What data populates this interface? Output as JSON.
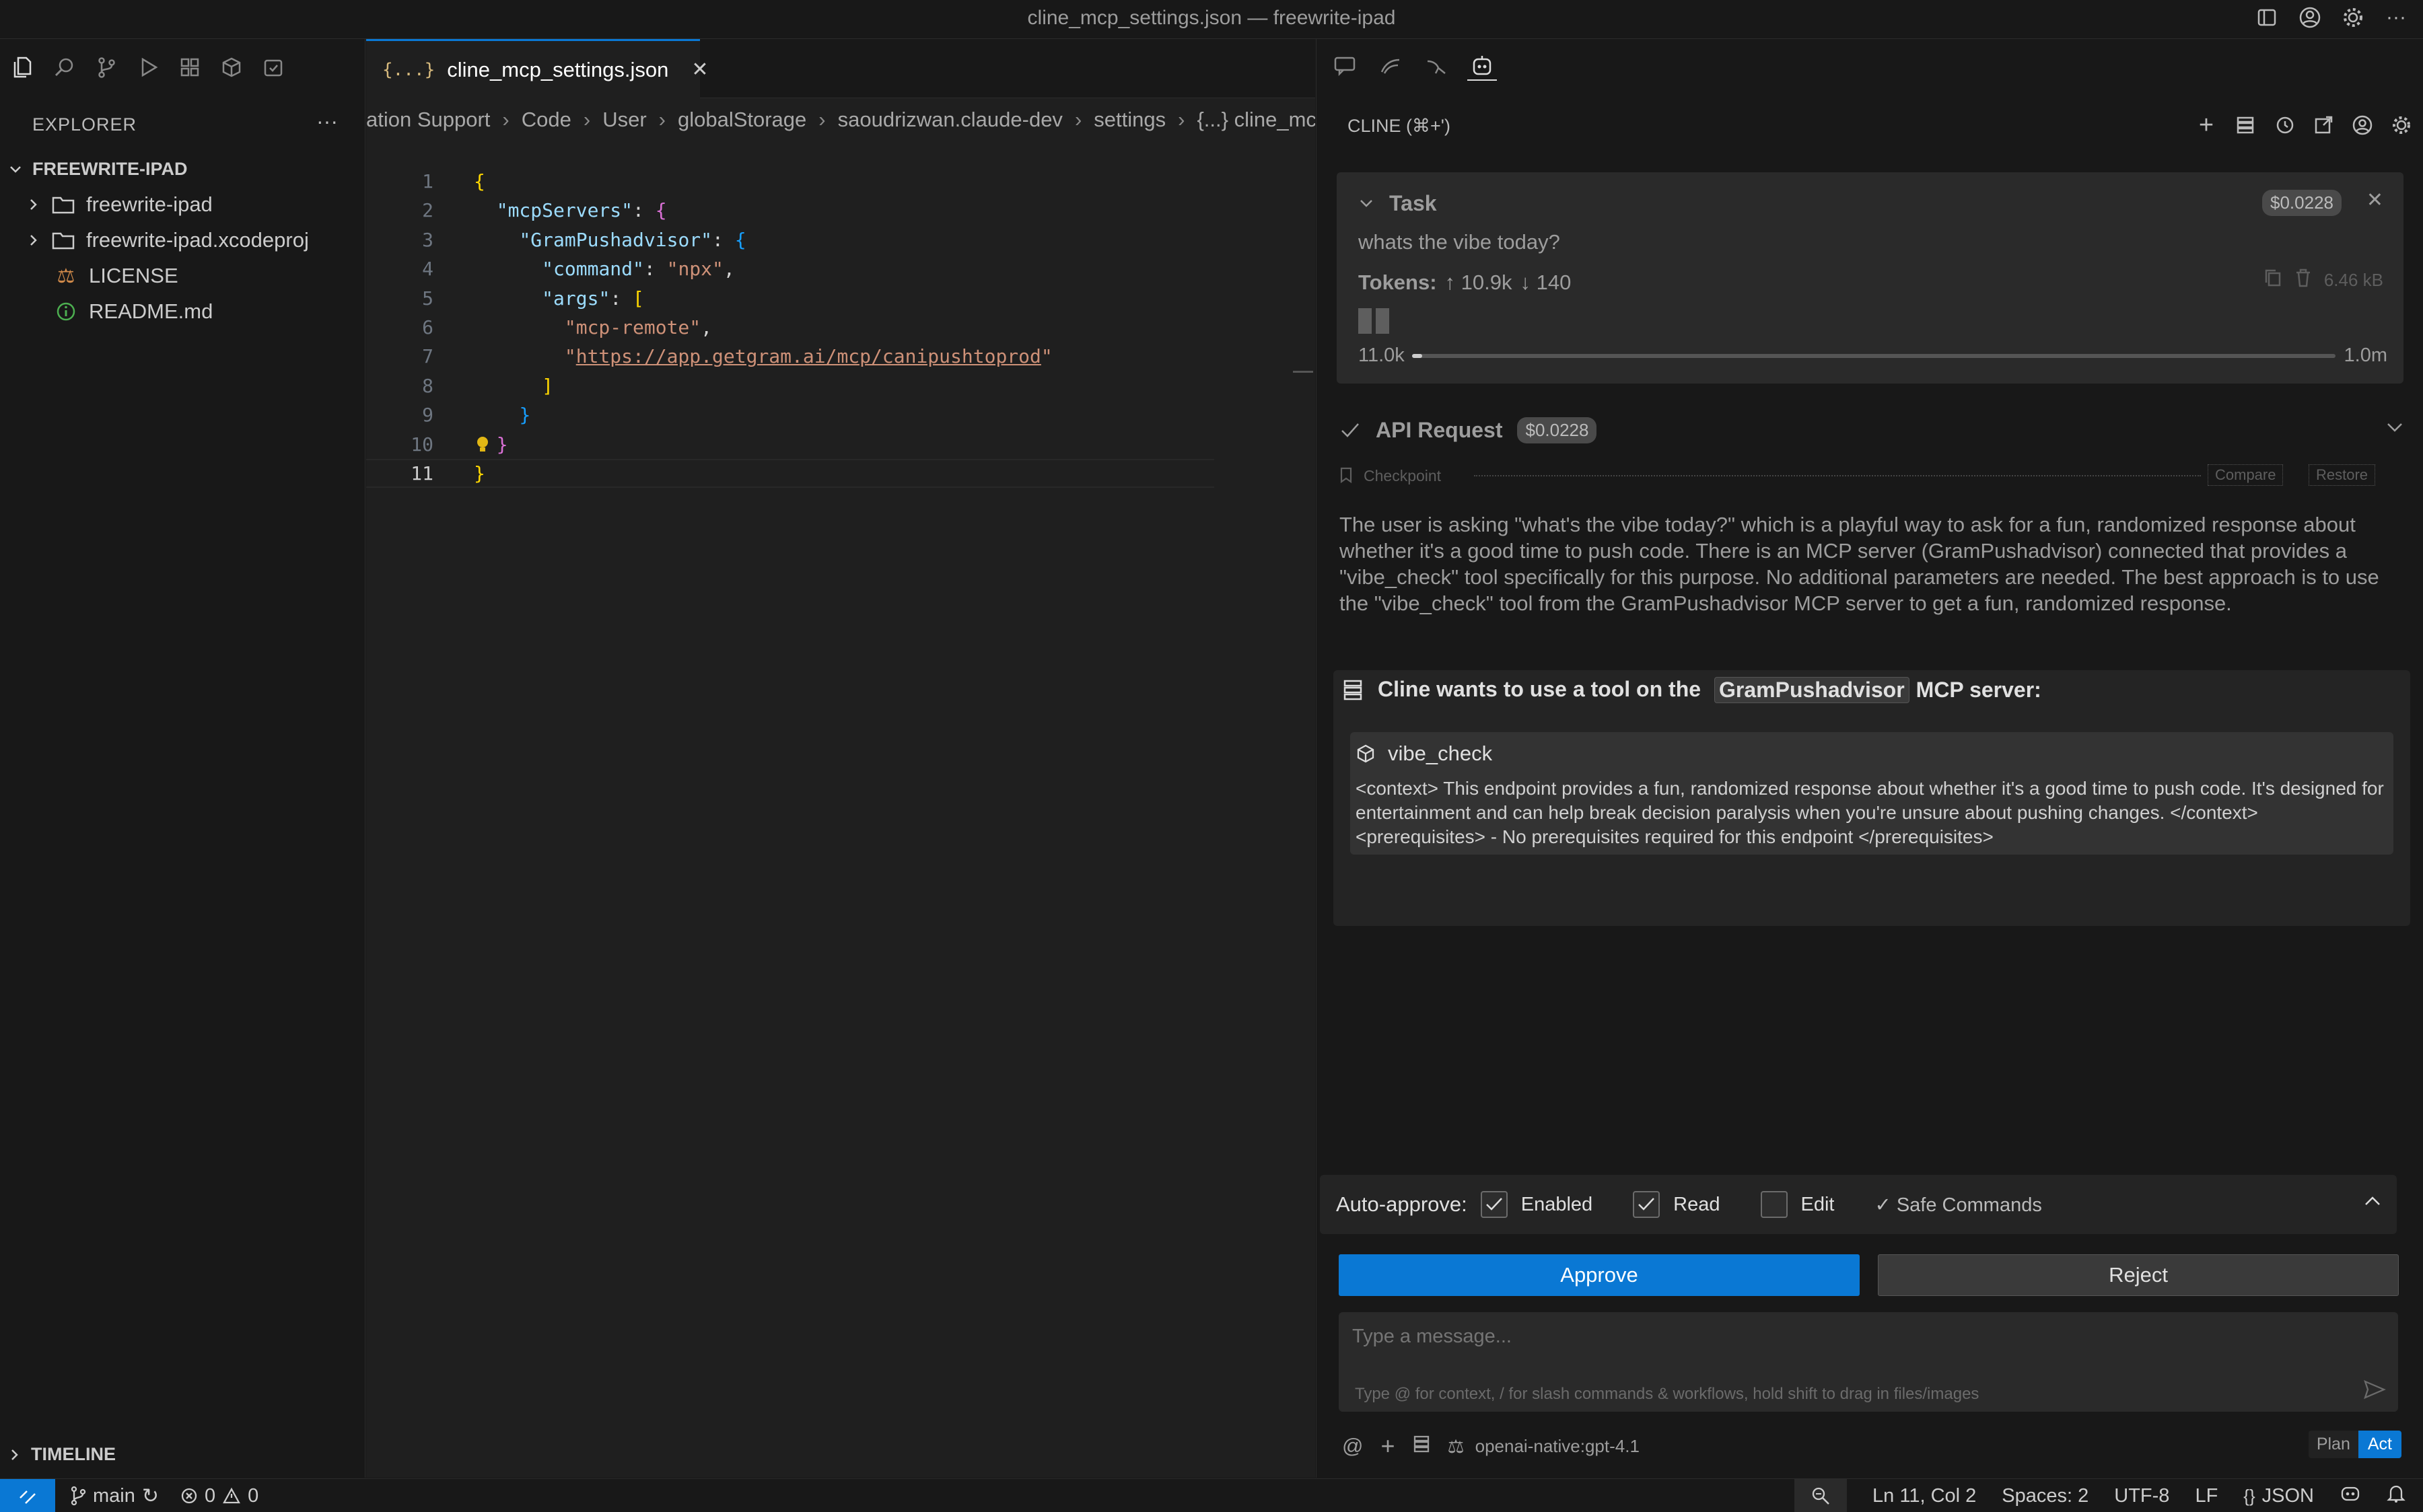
{
  "window": {
    "title": "cline_mcp_settings.json — freewrite-ipad"
  },
  "sidebar": {
    "header": "EXPLORER",
    "root": "FREEWRITE-IPAD",
    "items": [
      {
        "label": "freewrite-ipad",
        "type": "folder"
      },
      {
        "label": "freewrite-ipad.xcodeproj",
        "type": "folder"
      },
      {
        "label": "LICENSE",
        "type": "file"
      },
      {
        "label": "README.md",
        "type": "file"
      }
    ],
    "timeline": "TIMELINE"
  },
  "editor": {
    "tab_label": "cline_mcp_settings.json",
    "tab_icon": "{...}",
    "breadcrumbs": [
      "ation Support",
      "Code",
      "User",
      "globalStorage",
      "saoudrizwan.claude-dev",
      "settings",
      "{...} cline_mc"
    ],
    "line_numbers": [
      "1",
      "2",
      "3",
      "4",
      "5",
      "6",
      "7",
      "8",
      "9",
      "10",
      "11"
    ],
    "code": {
      "l1": "{",
      "l2_key": "\"mcpServers\"",
      "l2_rest": ": ",
      "l2_brace": "{",
      "l3_key": "\"GramPushadvisor\"",
      "l3_rest": ": ",
      "l3_brace": "{",
      "l4_key": "\"command\"",
      "l4_rest": ": ",
      "l4_val": "\"npx\"",
      "l4_end": ",",
      "l5_key": "\"args\"",
      "l5_rest": ": ",
      "l5_brace": "[",
      "l6_val": "\"mcp-remote\"",
      "l6_end": ",",
      "l7_q1": "\"",
      "l7_url": "https://app.getgram.ai/mcp/canipushtoprod",
      "l7_q2": "\"",
      "l8": "]",
      "l9": "}",
      "l10": "}",
      "l11": "}"
    }
  },
  "cline": {
    "header": "CLINE (⌘+')",
    "task": {
      "label": "Task",
      "cost": "$0.0228",
      "prompt": "whats the vibe today?",
      "tokens_label": "Tokens:",
      "tokens_in": "↑ 10.9k",
      "tokens_out": "↓ 140",
      "size": "6.46 kB",
      "context_used": "11.0k",
      "context_max": "1.0m",
      "context_fraction": 0.011
    },
    "api_request": {
      "label": "API Request",
      "cost": "$0.0228"
    },
    "checkpoint": {
      "label": "Checkpoint",
      "compare": "Compare",
      "restore": "Restore"
    },
    "reasoning": "The user is asking \"what's the vibe today?\" which is a playful way to ask for a fun, randomized response about whether it's a good time to push code. There is an MCP server (GramPushadvisor) connected that provides a \"vibe_check\" tool specifically for this purpose. No additional parameters are needed. The best approach is to use the \"vibe_check\" tool from the GramPushadvisor MCP server to get a fun, randomized response.",
    "tool_request": {
      "prefix": "Cline wants to use a tool on the",
      "server": "GramPushadvisor",
      "suffix": "MCP server:",
      "tool_name": "vibe_check",
      "description": "<context> This endpoint provides a fun, randomized response about whether it's a good time to push code. It's designed for entertainment and can help break decision paralysis when you're unsure about pushing changes. </context> <prerequisites> - No prerequisites required for this endpoint </prerequisites>"
    },
    "auto_approve": {
      "label": "Auto-approve:",
      "enabled": "Enabled",
      "read": "Read",
      "edit": "Edit",
      "safe": "✓ Safe Commands"
    },
    "approve_label": "Approve",
    "reject_label": "Reject",
    "input_placeholder": "Type a message...",
    "input_hint": "Type @ for context, / for slash commands & workflows, hold shift to drag in files/images",
    "model": "openai-native:gpt-4.1",
    "plan_label": "Plan",
    "act_label": "Act"
  },
  "status": {
    "branch": "main",
    "errors": "0",
    "warnings": "0",
    "position": "Ln 11, Col 2",
    "spaces": "Spaces: 2",
    "encoding": "UTF-8",
    "eol": "LF",
    "language": "JSON"
  },
  "colors": {
    "accent": "#0a78d4",
    "editor_bg": "#1f1f1f",
    "panel_bg": "#181818"
  }
}
